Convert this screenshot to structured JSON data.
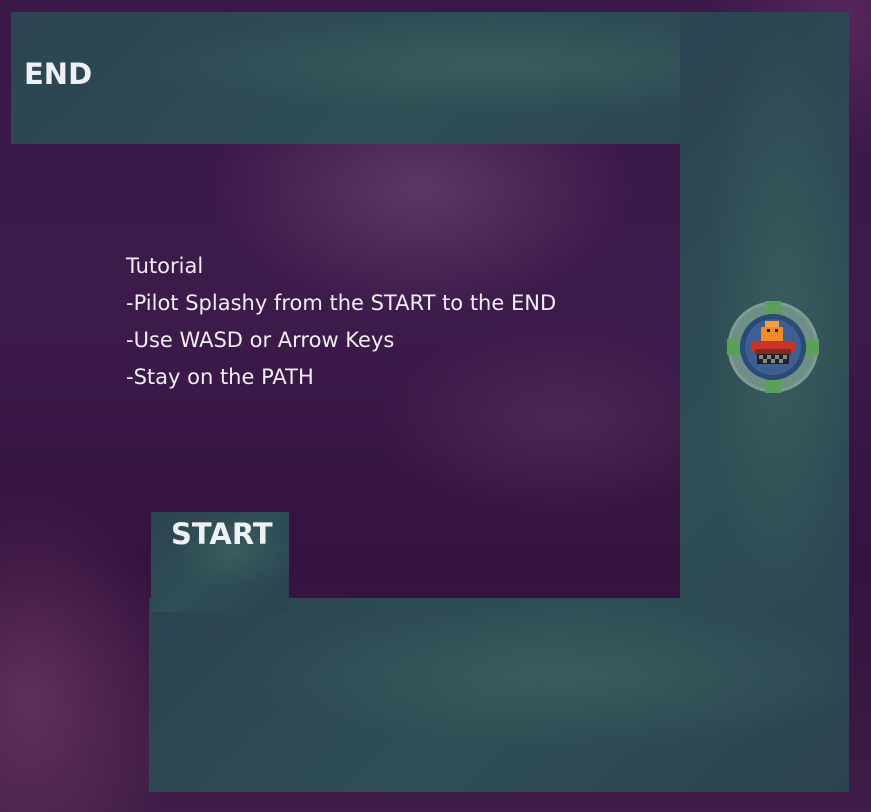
{
  "zones": {
    "end_label": "END",
    "start_label": "START"
  },
  "tutorial": {
    "title": "Tutorial",
    "lines": [
      "-Pilot Splashy from the START to the END",
      "-Use WASD or Arrow Keys",
      "-Stay on the PATH"
    ]
  },
  "player": {
    "icon": "splashy-duck-boat-icon"
  },
  "colors": {
    "background": "#3a1848",
    "path": "#2f4a54",
    "text": "#f0eef2",
    "ring_outer": "#6f8f86",
    "ring_inner": "#2a4a78",
    "duck_body": "#f08a2a",
    "boat_red": "#c8332a"
  }
}
